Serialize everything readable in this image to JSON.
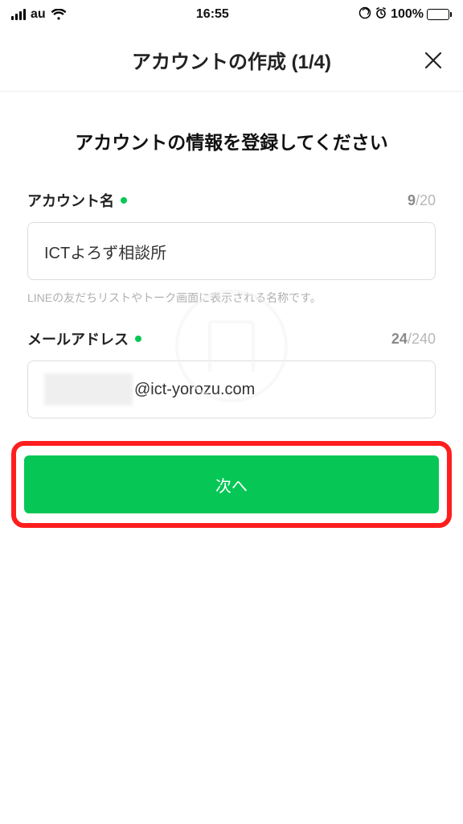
{
  "status": {
    "carrier": "au",
    "time": "16:55",
    "battery_pct": "100%"
  },
  "nav": {
    "title": "アカウントの作成 (1/4)"
  },
  "heading": "アカウントの情報を登録してください",
  "account": {
    "label": "アカウント名",
    "value": "ICTよろず相談所",
    "cur": "9",
    "max": "/20",
    "hint": "LINEの友だちリストやトーク画面に表示される名称です。"
  },
  "email": {
    "label": "メールアドレス",
    "visible": "@ict-yorozu.com",
    "cur": "24",
    "max": "/240"
  },
  "next_label": "次へ"
}
